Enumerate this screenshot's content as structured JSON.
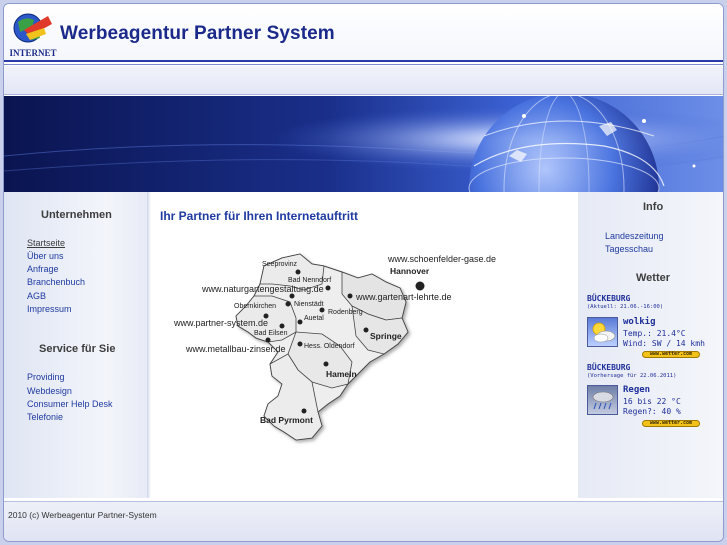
{
  "header": {
    "logo_text": "INTERNET",
    "title": "Werbeagentur Partner System"
  },
  "left_sidebar": {
    "company_heading": "Unternehmen",
    "company_links": [
      "Startseite",
      "Über uns",
      "Anfrage",
      "Branchenbuch",
      "AGB",
      "Impressum"
    ],
    "service_heading": "Service für Sie",
    "service_links": [
      "Providing",
      "Webdesign",
      "Consumer Help Desk",
      "Telefonie"
    ]
  },
  "main": {
    "title": "Ihr Partner für Ihren Internetauftritt",
    "map": {
      "cities": [
        "Seeprovinz",
        "Bad Nenndorf",
        "Obernkirchen",
        "Nienstädt",
        "Rodenberg",
        "Auetal",
        "Bad Eilsen",
        "Hess. Oldendorf",
        "Hannover",
        "Springe",
        "Hameln",
        "Bad Pyrmont"
      ],
      "websites": [
        "www.schoenfelder-gase.de",
        "www.naturgartengestaltung.de",
        "www.gartenart-lehrte.de",
        "www.partner-system.de",
        "www.metallbau-zinser.de"
      ]
    }
  },
  "right_sidebar": {
    "info_heading": "Info",
    "info_links": [
      "Landeszeitung",
      "Tagesschau"
    ],
    "weather_heading": "Wetter",
    "weather": [
      {
        "location": "BÜCKEBURG",
        "subtitle": "(Aktuell: 21.06.-16:00)",
        "condition": "wolkig",
        "line1": "Temp.: 21.4°C",
        "line2": "Wind: SW / 14 kmh",
        "badge": "www.wetter.com"
      },
      {
        "location": "BÜCKEBURG",
        "subtitle": "(Vorhersage für 22.06.2011)",
        "condition": "Regen",
        "line1": "16 bis 22 °C",
        "line2": "Regen?: 40 %",
        "badge": "www.wetter.com"
      }
    ]
  },
  "footer": {
    "text": "2010 (c) Werbeagentur Partner-System"
  },
  "colors": {
    "title_blue": "#1b2a8a",
    "link_blue": "#1f3aa0",
    "banner_dark": "#0a1450",
    "badge_yellow": "#f3c21a"
  }
}
